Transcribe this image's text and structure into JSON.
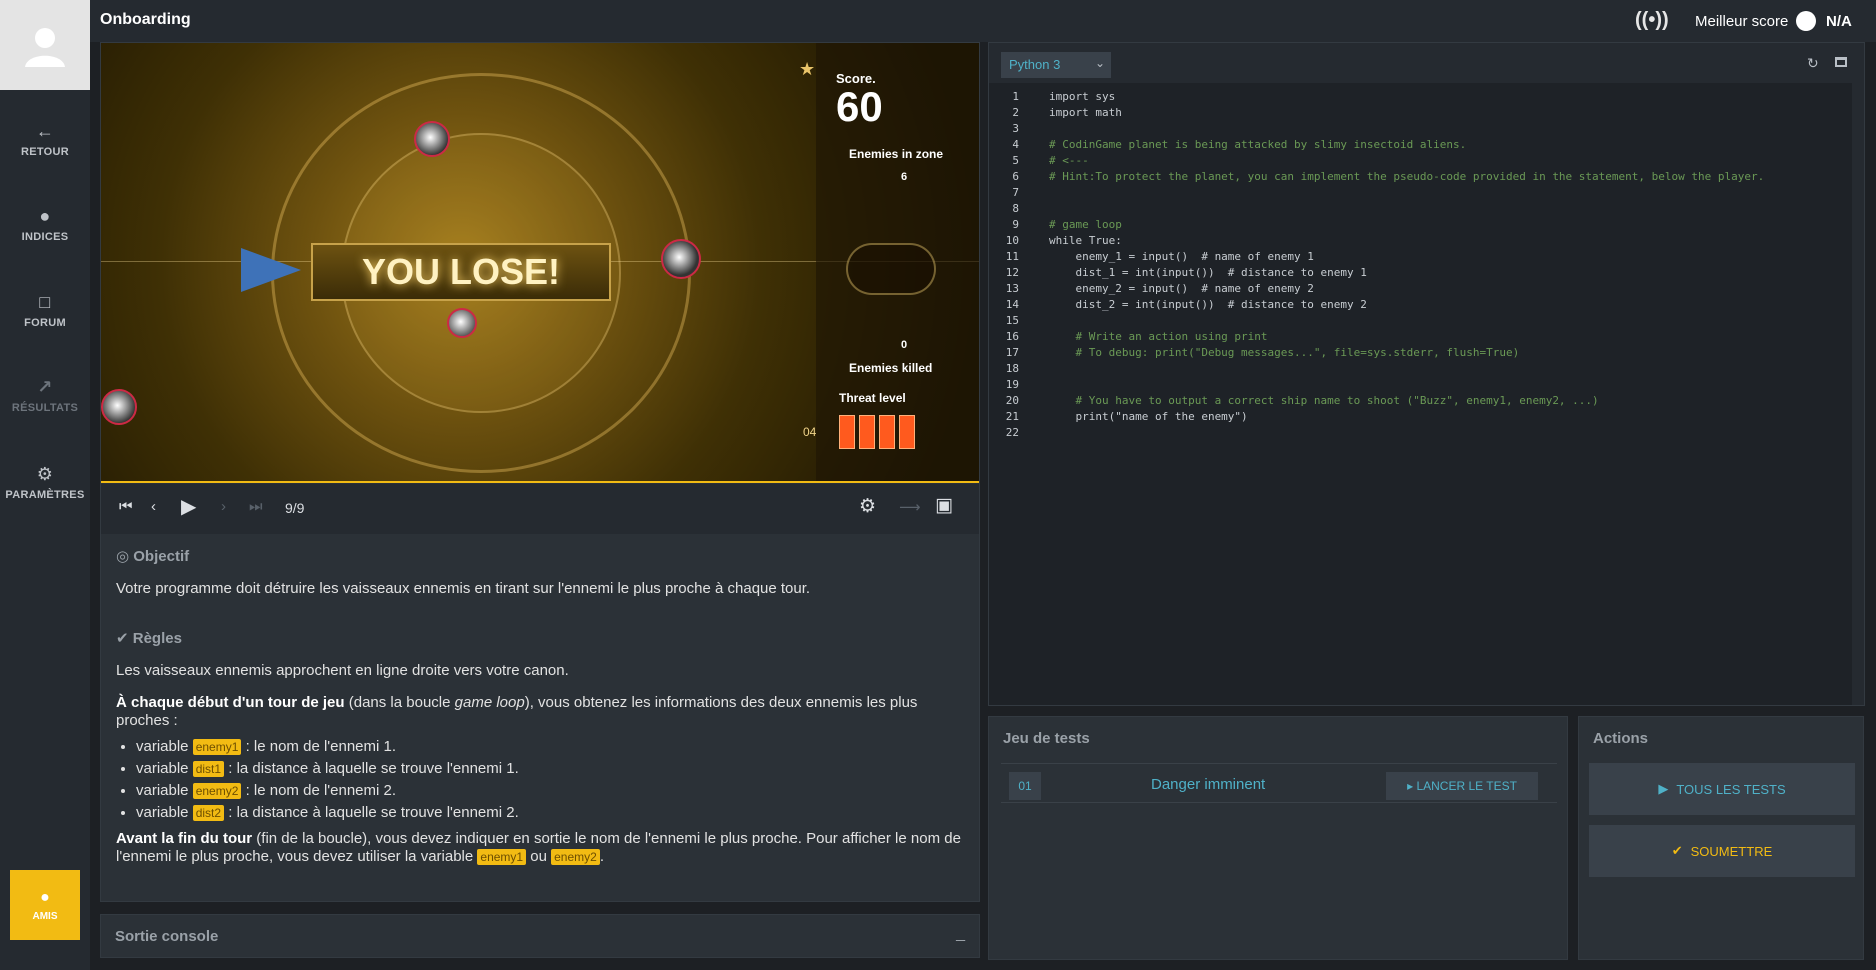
{
  "app": {
    "title": "Onboarding"
  },
  "sidebar": {
    "items": [
      {
        "label": "RETOUR",
        "icon": "arrow-left-icon"
      },
      {
        "label": "INDICES",
        "icon": "lightbulb-icon"
      },
      {
        "label": "FORUM",
        "icon": "forum-icon"
      },
      {
        "label": "RÉSULTATS",
        "icon": "chart-icon"
      },
      {
        "label": "PARAMÈTRES",
        "icon": "gear-icon"
      }
    ],
    "friends_label": "AMIS"
  },
  "header": {
    "best_score_label": "Meilleur score",
    "best_score_value": "N/A"
  },
  "game": {
    "banner": "YOU LOSE!",
    "score_label": "Score.",
    "score_value": "60",
    "enemies_in_zone_label": "Enemies in zone",
    "enemies_in_zone_value": "6",
    "enemies_killed_label": "Enemies killed",
    "enemies_killed_value": "0",
    "threat_label": "Threat level",
    "threat_number": "04"
  },
  "player": {
    "frame": "9/9"
  },
  "statement": {
    "objective_title": "Objectif",
    "objective_text": "Votre programme doit détruire les vaisseaux ennemis en tirant sur l'ennemi le plus proche à chaque tour.",
    "rules_title": "Règles",
    "rules_intro": "Les vaisseaux ennemis approchent en ligne droite vers votre canon.",
    "turn_start_bold": "À chaque début d'un tour de jeu",
    "turn_start_mid": " (dans la boucle ",
    "turn_start_italic": "game loop",
    "turn_start_rest": "), vous obtenez les informations des deux ennemis les plus proches :",
    "var_prefix": "variable",
    "variables": [
      {
        "name": "enemy1",
        "desc": " : le nom de l'ennemi 1."
      },
      {
        "name": "dist1",
        "desc": " : la distance à laquelle se trouve l'ennemi 1."
      },
      {
        "name": "enemy2",
        "desc": " : le nom de l'ennemi 2."
      },
      {
        "name": "dist2",
        "desc": " : la distance à laquelle se trouve l'ennemi 2."
      }
    ],
    "turn_end_bold": "Avant la fin du tour",
    "turn_end_rest": " (fin de la boucle), vous devez indiquer en sortie le nom de l'ennemi le plus proche. Pour afficher le nom de l'ennemi le plus proche, vous devez utiliser la variable ",
    "turn_end_var1": "enemy1",
    "turn_end_or": " ou ",
    "turn_end_var2": "enemy2",
    "turn_end_dot": "."
  },
  "console": {
    "title": "Sortie console",
    "minimize": "_"
  },
  "editor": {
    "language": "Python 3",
    "lines": [
      {
        "n": "1",
        "text": "import sys",
        "type": "code"
      },
      {
        "n": "2",
        "text": "import math",
        "type": "code"
      },
      {
        "n": "3",
        "text": "",
        "type": "code"
      },
      {
        "n": "4",
        "text": "# CodinGame planet is being attacked by slimy insectoid aliens.",
        "type": "comment"
      },
      {
        "n": "5",
        "text": "# <---",
        "type": "comment"
      },
      {
        "n": "6",
        "text": "# Hint:To protect the planet, you can implement the pseudo-code provided in the statement, below the player.",
        "type": "comment"
      },
      {
        "n": "7",
        "text": "",
        "type": "code"
      },
      {
        "n": "8",
        "text": "",
        "type": "code"
      },
      {
        "n": "9",
        "text": "# game loop",
        "type": "comment"
      },
      {
        "n": "10",
        "text": "while True:",
        "type": "code"
      },
      {
        "n": "11",
        "text": "    enemy_1 = input()  # name of enemy 1",
        "type": "code"
      },
      {
        "n": "12",
        "text": "    dist_1 = int(input())  # distance to enemy 1",
        "type": "code"
      },
      {
        "n": "13",
        "text": "    enemy_2 = input()  # name of enemy 2",
        "type": "code"
      },
      {
        "n": "14",
        "text": "    dist_2 = int(input())  # distance to enemy 2",
        "type": "code"
      },
      {
        "n": "15",
        "text": "",
        "type": "code"
      },
      {
        "n": "16",
        "text": "    # Write an action using print",
        "type": "comment"
      },
      {
        "n": "17",
        "text": "    # To debug: print(\"Debug messages...\", file=sys.stderr, flush=True)",
        "type": "comment"
      },
      {
        "n": "18",
        "text": "",
        "type": "code"
      },
      {
        "n": "19",
        "text": "",
        "type": "code"
      },
      {
        "n": "20",
        "text": "    # You have to output a correct ship name to shoot (\"Buzz\", enemy1, enemy2, ...)",
        "type": "comment"
      },
      {
        "n": "21",
        "text": "    print(\"name of the enemy\")",
        "type": "code"
      },
      {
        "n": "22",
        "text": "",
        "type": "code"
      }
    ]
  },
  "tests": {
    "title": "Jeu de tests",
    "items": [
      {
        "number": "01",
        "name": "Danger imminent",
        "launch_label": "LANCER LE TEST"
      }
    ]
  },
  "actions": {
    "title": "Actions",
    "run_all_label": "TOUS LES TESTS",
    "submit_label": "SOUMETTRE"
  },
  "colors": {
    "accent": "#f2bb13",
    "link": "#4fb1c8",
    "background": "#1d2024",
    "panel": "#2b3137"
  }
}
